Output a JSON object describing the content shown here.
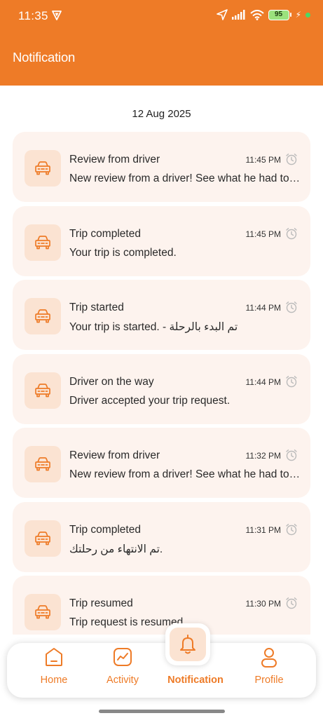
{
  "status_bar": {
    "time": "11:35",
    "battery": "95"
  },
  "header": {
    "title": "Notification"
  },
  "date": "12 Aug 2025",
  "notifications": [
    {
      "title": "Review from driver",
      "time": "11:45 PM",
      "body": "New review from a driver! See what he had to say"
    },
    {
      "title": "Trip completed",
      "time": "11:45 PM",
      "body": "Your trip is completed."
    },
    {
      "title": "Trip started",
      "time": "11:44 PM",
      "body": "Your trip is started. - تم البدء بالرحلة"
    },
    {
      "title": "Driver on the way",
      "time": "11:44 PM",
      "body": "Driver accepted your trip request."
    },
    {
      "title": "Review from driver",
      "time": "11:32 PM",
      "body": "New review from a driver! See what he had to say"
    },
    {
      "title": "Trip completed",
      "time": "11:31 PM",
      "body": "تم الانتهاء من رحلتك."
    },
    {
      "title": "Trip resumed",
      "time": "11:30 PM",
      "body": "Trip request is resumed."
    }
  ],
  "nav": {
    "home": "Home",
    "activity": "Activity",
    "notification": "Notification",
    "profile": "Profile"
  },
  "colors": {
    "accent": "#EE7B27",
    "card_bg": "#FDF3EE",
    "icon_bg": "#FBE3D2"
  }
}
